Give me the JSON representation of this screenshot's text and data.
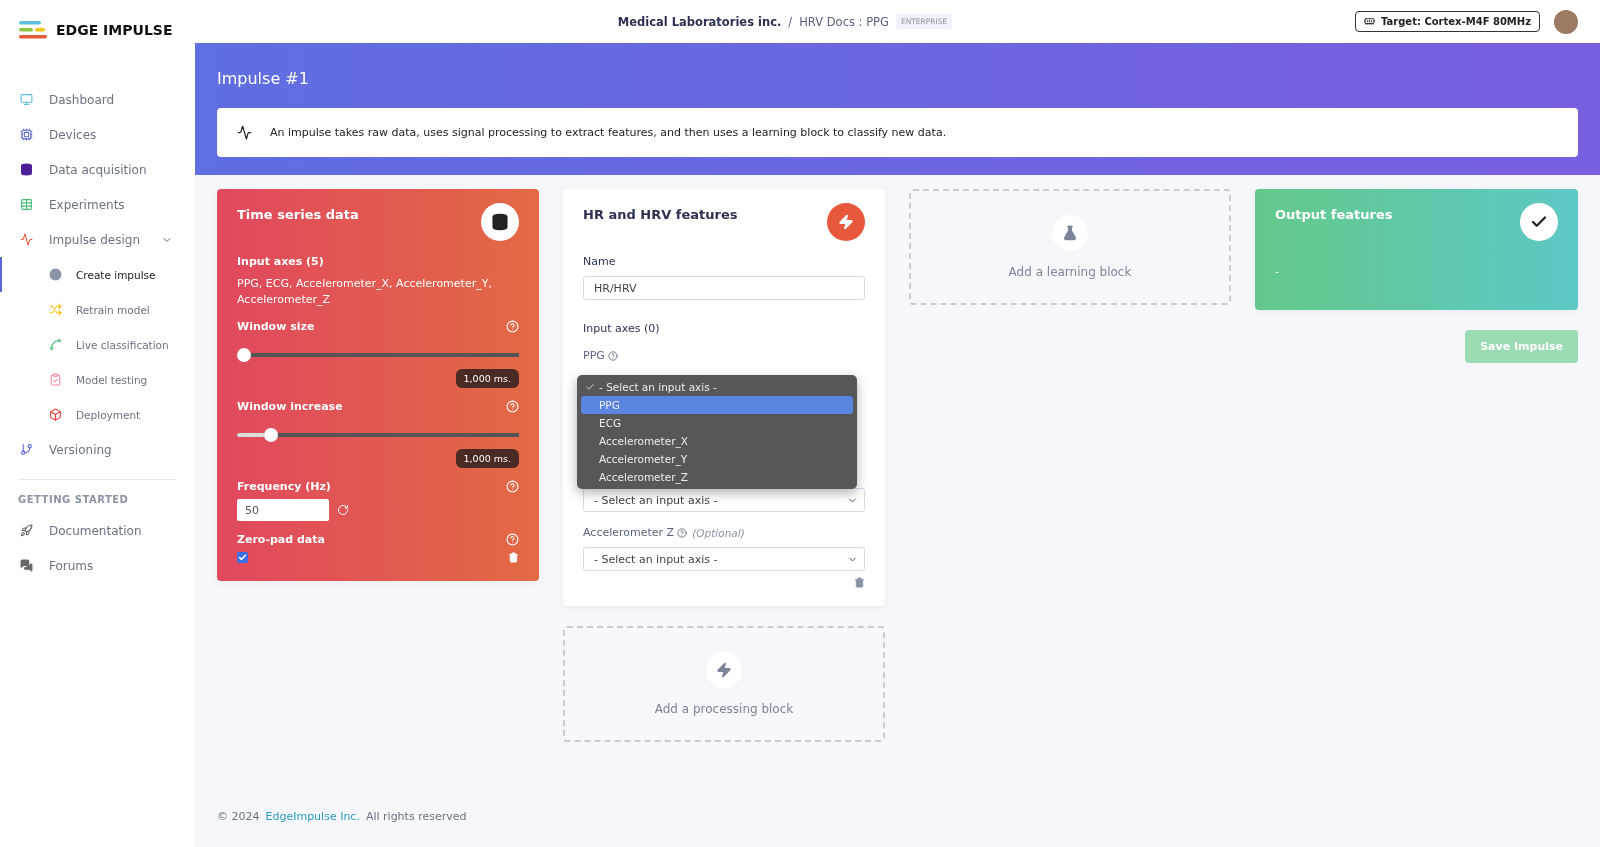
{
  "brand": {
    "name": "EDGE IMPULSE"
  },
  "sidebar": {
    "items": [
      {
        "label": "Dashboard",
        "selected": false
      },
      {
        "label": "Devices",
        "selected": false
      },
      {
        "label": "Data acquisition",
        "selected": false
      },
      {
        "label": "Experiments",
        "selected": false
      },
      {
        "label": "Impulse design",
        "selected": false,
        "expanded": true,
        "children": [
          {
            "label": "Create impulse",
            "selected": true
          },
          {
            "label": "Retrain model",
            "selected": false
          },
          {
            "label": "Live classification",
            "selected": false
          },
          {
            "label": "Model testing",
            "selected": false
          },
          {
            "label": "Deployment",
            "selected": false
          }
        ]
      },
      {
        "label": "Versioning",
        "selected": false
      }
    ],
    "section_title": "GETTING STARTED",
    "help_items": [
      {
        "label": "Documentation"
      },
      {
        "label": "Forums"
      }
    ]
  },
  "header": {
    "organization": "Medical Laboratories inc.",
    "separator": "/",
    "project": "HRV Docs : PPG",
    "badge": "ENTERPRISE",
    "target": "Target: Cortex-M4F 80MHz"
  },
  "page": {
    "title": "Impulse #1",
    "info": "An impulse takes raw data, uses signal processing to extract features, and then uses a learning block to classify new data."
  },
  "time_series": {
    "title": "Time series data",
    "axes_label": "Input axes (5)",
    "axes": "PPG, ECG, Accelerometer_X, Accelerometer_Y, Accelerometer_Z",
    "sliders": [
      {
        "label": "Window size",
        "level": 0,
        "reading": "1,000 ms."
      },
      {
        "label": "Window increase",
        "level": 0.1,
        "reading": "1,000 ms."
      }
    ],
    "frequency": {
      "label": "Frequency (Hz)",
      "value": "50"
    },
    "zero_pad": {
      "label": "Zero-pad data",
      "checked": true
    }
  },
  "processing": {
    "title": "HR and HRV features",
    "name_label": "Name",
    "name_value": "HR/HRV",
    "axes_label": "Input axes (0)",
    "first_axis_label": "PPG",
    "dropdown": {
      "options": [
        {
          "label": "- Select an input axis -",
          "checked": true,
          "selected": false
        },
        {
          "label": "PPG",
          "checked": false,
          "selected": true
        },
        {
          "label": "ECG",
          "checked": false,
          "selected": false
        },
        {
          "label": "Accelerometer_X",
          "checked": false,
          "selected": false
        },
        {
          "label": "Accelerometer_Y",
          "checked": false,
          "selected": false
        },
        {
          "label": "Accelerometer_Z",
          "checked": false,
          "selected": false
        }
      ]
    },
    "visible_select": "- Select an input axis -",
    "last_axis": {
      "label": "Accelerometer Z",
      "optional": "(Optional)",
      "value": "- Select an input axis -"
    }
  },
  "add_processing": "Add a processing block",
  "add_learning": "Add a learning block",
  "output": {
    "title": "Output features",
    "value": "-"
  },
  "save_button": {
    "label": "Save Impulse",
    "disabled": true
  },
  "footer": {
    "copyright": "© 2024",
    "link": "EdgeImpulse Inc.",
    "rights": "All rights reserved"
  }
}
